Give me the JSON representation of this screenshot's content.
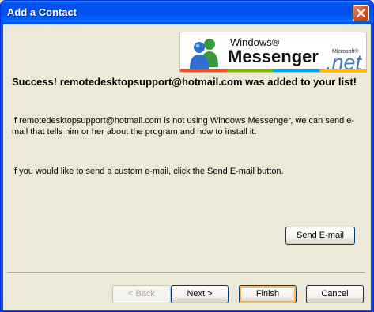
{
  "window": {
    "title": "Add a Contact"
  },
  "logo": {
    "windows": "Windows®",
    "messenger": "Messenger",
    "microsoft": "Microsoft®",
    "net": ".net"
  },
  "content": {
    "headline": "Success! remotedesktopsupport@hotmail.com was added to your list!",
    "paragraph1": "If remotedesktopsupport@hotmail.com is not using Windows Messenger, we can send e-mail that tells him or her about the program and how to install it.",
    "paragraph2": "If you would like to send a custom e-mail, click the Send E-mail button."
  },
  "buttons": {
    "send_email": "Send E-mail",
    "back": "< Back",
    "next": "Next >",
    "finish": "Finish",
    "cancel": "Cancel"
  },
  "icons": {
    "close": "close-icon",
    "logo": "messenger-people-icon"
  },
  "colors": {
    "titlebar": "#0053EE",
    "face": "#ECE9D8",
    "close": "#D64E29",
    "default_focus": "#F8B33F"
  }
}
